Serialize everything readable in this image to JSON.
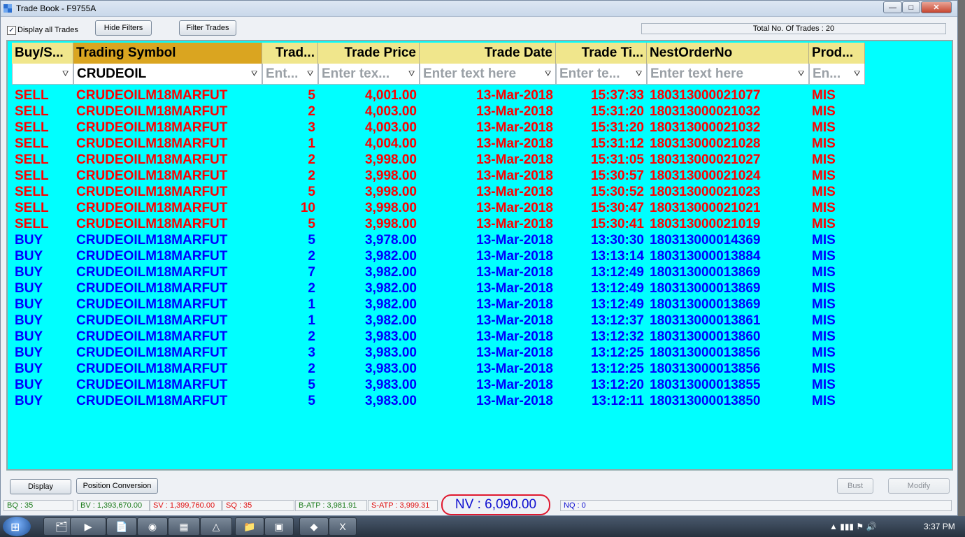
{
  "window": {
    "title": "Trade Book - F9755A",
    "minimize": "—",
    "maximize": "□",
    "close": "✕"
  },
  "toolbar": {
    "display_all_label": "Display all Trades",
    "display_all_checked": true,
    "hide_filters": "Hide Filters",
    "filter_trades": "Filter Trades",
    "total_trades": "Total No. Of Trades : 20"
  },
  "grid": {
    "columns": [
      {
        "key": "side",
        "header": "Buy/S...",
        "filter_value": "",
        "filter_placeholder": ""
      },
      {
        "key": "symbol",
        "header": "Trading Symbol",
        "filter_value": "CRUDEOIL",
        "filter_placeholder": ""
      },
      {
        "key": "qty",
        "header": "Trad...",
        "filter_value": "",
        "filter_placeholder": "Ent..."
      },
      {
        "key": "price",
        "header": "Trade Price",
        "filter_value": "",
        "filter_placeholder": "Enter tex..."
      },
      {
        "key": "date",
        "header": "Trade Date",
        "filter_value": "",
        "filter_placeholder": "Enter text here"
      },
      {
        "key": "time",
        "header": "Trade Ti...",
        "filter_value": "",
        "filter_placeholder": "Enter te..."
      },
      {
        "key": "order",
        "header": "NestOrderNo",
        "filter_value": "",
        "filter_placeholder": "Enter text here"
      },
      {
        "key": "product",
        "header": "Prod...",
        "filter_value": "",
        "filter_placeholder": "En..."
      }
    ],
    "colors": {
      "sell": "#ff0000",
      "buy": "#0000ff",
      "background": "#00ffff",
      "header": "#f0e68c",
      "sorted_header": "#daa520"
    },
    "rows": [
      [
        "SELL",
        "CRUDEOILM18MARFUT",
        "5",
        "4,001.00",
        "13-Mar-2018",
        "15:37:33",
        "180313000021077",
        "MIS"
      ],
      [
        "SELL",
        "CRUDEOILM18MARFUT",
        "2",
        "4,003.00",
        "13-Mar-2018",
        "15:31:20",
        "180313000021032",
        "MIS"
      ],
      [
        "SELL",
        "CRUDEOILM18MARFUT",
        "3",
        "4,003.00",
        "13-Mar-2018",
        "15:31:20",
        "180313000021032",
        "MIS"
      ],
      [
        "SELL",
        "CRUDEOILM18MARFUT",
        "1",
        "4,004.00",
        "13-Mar-2018",
        "15:31:12",
        "180313000021028",
        "MIS"
      ],
      [
        "SELL",
        "CRUDEOILM18MARFUT",
        "2",
        "3,998.00",
        "13-Mar-2018",
        "15:31:05",
        "180313000021027",
        "MIS"
      ],
      [
        "SELL",
        "CRUDEOILM18MARFUT",
        "2",
        "3,998.00",
        "13-Mar-2018",
        "15:30:57",
        "180313000021024",
        "MIS"
      ],
      [
        "SELL",
        "CRUDEOILM18MARFUT",
        "5",
        "3,998.00",
        "13-Mar-2018",
        "15:30:52",
        "180313000021023",
        "MIS"
      ],
      [
        "SELL",
        "CRUDEOILM18MARFUT",
        "10",
        "3,998.00",
        "13-Mar-2018",
        "15:30:47",
        "180313000021021",
        "MIS"
      ],
      [
        "SELL",
        "CRUDEOILM18MARFUT",
        "5",
        "3,998.00",
        "13-Mar-2018",
        "15:30:41",
        "180313000021019",
        "MIS"
      ],
      [
        "BUY",
        "CRUDEOILM18MARFUT",
        "5",
        "3,978.00",
        "13-Mar-2018",
        "13:30:30",
        "180313000014369",
        "MIS"
      ],
      [
        "BUY",
        "CRUDEOILM18MARFUT",
        "2",
        "3,982.00",
        "13-Mar-2018",
        "13:13:14",
        "180313000013884",
        "MIS"
      ],
      [
        "BUY",
        "CRUDEOILM18MARFUT",
        "7",
        "3,982.00",
        "13-Mar-2018",
        "13:12:49",
        "180313000013869",
        "MIS"
      ],
      [
        "BUY",
        "CRUDEOILM18MARFUT",
        "2",
        "3,982.00",
        "13-Mar-2018",
        "13:12:49",
        "180313000013869",
        "MIS"
      ],
      [
        "BUY",
        "CRUDEOILM18MARFUT",
        "1",
        "3,982.00",
        "13-Mar-2018",
        "13:12:49",
        "180313000013869",
        "MIS"
      ],
      [
        "BUY",
        "CRUDEOILM18MARFUT",
        "1",
        "3,982.00",
        "13-Mar-2018",
        "13:12:37",
        "180313000013861",
        "MIS"
      ],
      [
        "BUY",
        "CRUDEOILM18MARFUT",
        "2",
        "3,983.00",
        "13-Mar-2018",
        "13:12:32",
        "180313000013860",
        "MIS"
      ],
      [
        "BUY",
        "CRUDEOILM18MARFUT",
        "3",
        "3,983.00",
        "13-Mar-2018",
        "13:12:25",
        "180313000013856",
        "MIS"
      ],
      [
        "BUY",
        "CRUDEOILM18MARFUT",
        "2",
        "3,983.00",
        "13-Mar-2018",
        "13:12:25",
        "180313000013856",
        "MIS"
      ],
      [
        "BUY",
        "CRUDEOILM18MARFUT",
        "5",
        "3,983.00",
        "13-Mar-2018",
        "13:12:20",
        "180313000013855",
        "MIS"
      ],
      [
        "BUY",
        "CRUDEOILM18MARFUT",
        "5",
        "3,983.00",
        "13-Mar-2018",
        "13:12:11",
        "180313000013850",
        "MIS"
      ]
    ]
  },
  "actions": {
    "display": "Display",
    "position_conversion": "Position Conversion",
    "bust": "Bust",
    "modify": "Modify"
  },
  "status": {
    "bq": "BQ : 35",
    "bv": "BV : 1,393,670.00",
    "sv": "SV : 1,399,760.00",
    "sq": "SQ : 35",
    "batp": "B-ATP : 3,981.91",
    "satp": "S-ATP : 3,999.31",
    "nv": "NV : 6,090.00",
    "nq": "NQ : 0"
  },
  "taskbar": {
    "start_glyph": "⊞",
    "apps": [
      "explorer-icon",
      "media-player-icon",
      "file-icon",
      "chrome-icon",
      "calculator-icon",
      "paint-icon",
      "folder-icon",
      "window-icon",
      "trading-app-icon",
      "excel-icon"
    ],
    "tray_text": "▲ ▮▮▮ ⚑ 🔊",
    "clock": "3:37 PM"
  }
}
